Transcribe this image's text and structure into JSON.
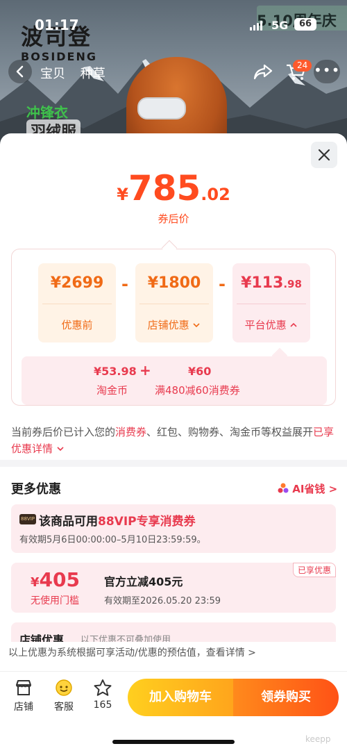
{
  "background": {
    "brand_cn": "波司登",
    "brand_en": "BOSIDENG",
    "promo": "5.10周年庆",
    "tag1": "冲锋衣",
    "tag2": "羽绒服"
  },
  "status_bar": {
    "time": "01:17",
    "network": "5G",
    "battery": "66"
  },
  "nav": {
    "tabs": [
      "宝贝",
      "种草"
    ],
    "cart_count": "24"
  },
  "price": {
    "currency": "¥",
    "integer": "785",
    "decimal": ".02",
    "label": "券后价"
  },
  "breakdown": {
    "original": {
      "value": "¥2699",
      "label": "优惠前"
    },
    "shop": {
      "value": "¥1800",
      "label": "店铺优惠"
    },
    "platform": {
      "value_int": "¥113",
      "value_dec": ".98",
      "label": "平台优惠"
    },
    "minus": "-",
    "plus": "+",
    "taojin": {
      "value": "¥53.98",
      "label": "淘金币"
    },
    "coupon": {
      "value": "¥60",
      "label": "满480减60消费券"
    }
  },
  "note": {
    "prefix": "当前券后价已计入您的",
    "hl1": "消费券",
    "middle": "、红包、购物券、淘金币等权益展开",
    "hl2": "已享优惠详情"
  },
  "more": {
    "title": "更多优惠",
    "ai_link": "AI省钱 >",
    "vip_badge": "88VIP",
    "vip_title_prefix": "该商品可用",
    "vip_title_hl": "88VIP专享消费券",
    "vip_validity": "有效期5月6日00:00:00–5月10日23:59:59。",
    "coupon_yen": "¥",
    "coupon_amount": "405",
    "coupon_threshold": "无使用门槛",
    "coupon_title": "官方立减405元",
    "coupon_validity": "有效期至2026.05.20 23:59",
    "enjoyed": "已享优惠",
    "shop_title": "店铺优惠",
    "shop_sub": "以下优惠不可叠加使用"
  },
  "disclaimer": "以上优惠为系统根据可享活动/优惠的预估值，查看详情 >",
  "bottom": {
    "store": "店铺",
    "service": "客服",
    "favorites": "165",
    "add_cart": "加入购物车",
    "buy": "领券购买",
    "watermark": "keepp"
  },
  "colors": {
    "accent_orange": "#ff4b1f",
    "accent_pink": "#e83a4e",
    "cart_yellow": "#ffcf1f",
    "buy_orange": "#ff5216"
  }
}
